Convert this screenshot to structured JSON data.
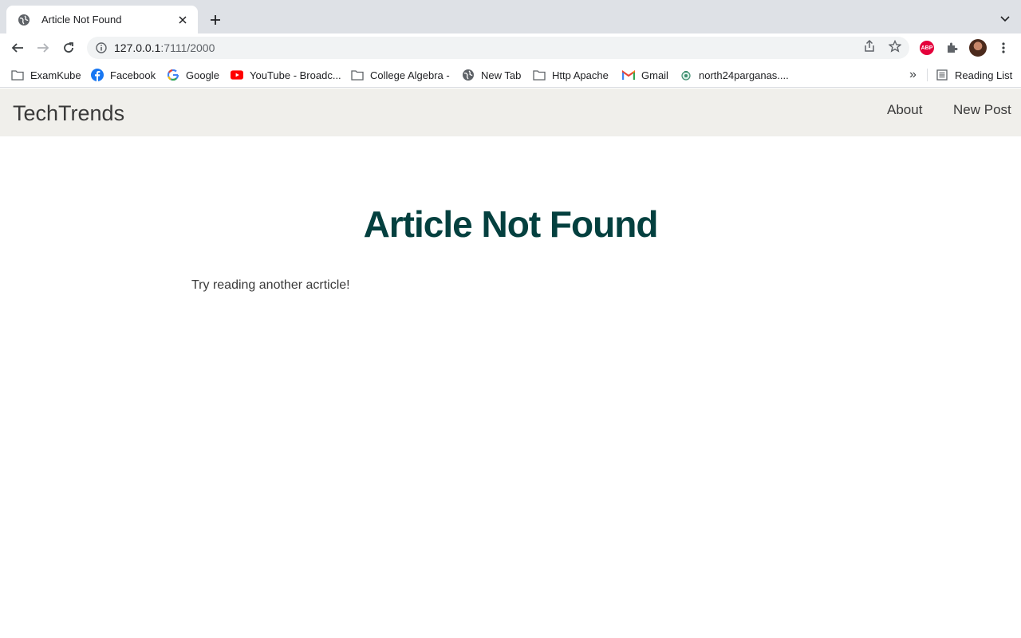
{
  "browser": {
    "tab": {
      "title": "Article Not Found"
    },
    "url": {
      "host": "127.0.0.1",
      "path": ":7111/2000"
    },
    "bookmarks": [
      {
        "label": "ExamKube",
        "icon": "folder-icon"
      },
      {
        "label": "Facebook",
        "icon": "facebook-icon"
      },
      {
        "label": "Google",
        "icon": "google-icon"
      },
      {
        "label": "YouTube - Broadc...",
        "icon": "youtube-icon"
      },
      {
        "label": "College Algebra -",
        "icon": "folder-icon"
      },
      {
        "label": "New Tab",
        "icon": "globe-icon"
      },
      {
        "label": "Http Apache",
        "icon": "folder-icon"
      },
      {
        "label": "Gmail",
        "icon": "gmail-icon"
      },
      {
        "label": "north24parganas....",
        "icon": "emblem-icon"
      }
    ],
    "more_bookmarks": "»",
    "reading_list": "Reading List",
    "extension_abp": "ABP"
  },
  "site": {
    "brand": "TechTrends",
    "nav": [
      {
        "label": "About"
      },
      {
        "label": "New Post"
      }
    ]
  },
  "content": {
    "title": "Article Not Found",
    "message": "Try reading another acrticle!"
  },
  "colors": {
    "header_bg": "#f0efeb",
    "title": "#04403f",
    "text": "#3a3a3a"
  }
}
